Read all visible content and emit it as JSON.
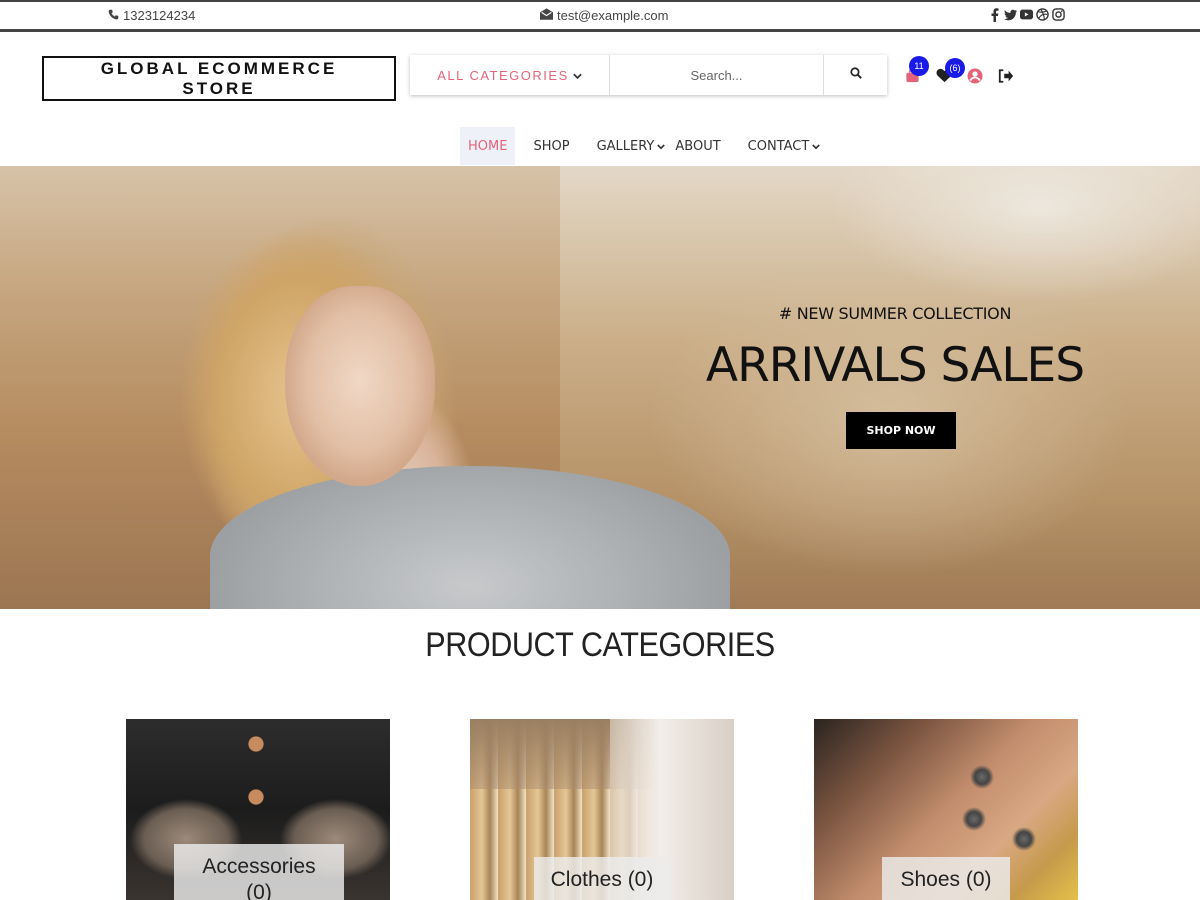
{
  "topbar": {
    "phone": "1323124234",
    "email": "test@example.com",
    "social_icons": [
      "facebook-icon",
      "twitter-icon",
      "youtube-icon",
      "dribbble-icon",
      "instagram-icon"
    ]
  },
  "header": {
    "logo_line1": "GLOBAL ECOMMERCE",
    "logo_line2": "STORE",
    "categories_label": "ALL CATEGORIES",
    "search_placeholder": "Search...",
    "cart_count": "11",
    "wishlist_count": "(6)"
  },
  "nav": {
    "items": [
      {
        "label": "HOME",
        "active": true,
        "dropdown": false
      },
      {
        "label": "SHOP",
        "active": false,
        "dropdown": false
      },
      {
        "label": "GALLERY",
        "active": false,
        "dropdown": true
      },
      {
        "label": "ABOUT",
        "active": false,
        "dropdown": false
      },
      {
        "label": "CONTACT",
        "active": false,
        "dropdown": true
      }
    ]
  },
  "hero": {
    "subtitle": "# NEW SUMMER COLLECTION",
    "title": "ARRIVALS SALES",
    "button": "SHOP NOW"
  },
  "categories": {
    "title": "PRODUCT CATEGORIES",
    "items": [
      {
        "name": "Accessories",
        "count": "(0)"
      },
      {
        "name": "Clothes",
        "count": "(0)"
      },
      {
        "name": "Shoes",
        "count": "(0)"
      }
    ]
  },
  "colors": {
    "accent": "#e3647a",
    "badge": "#1a1ae6",
    "dark": "#000000"
  }
}
